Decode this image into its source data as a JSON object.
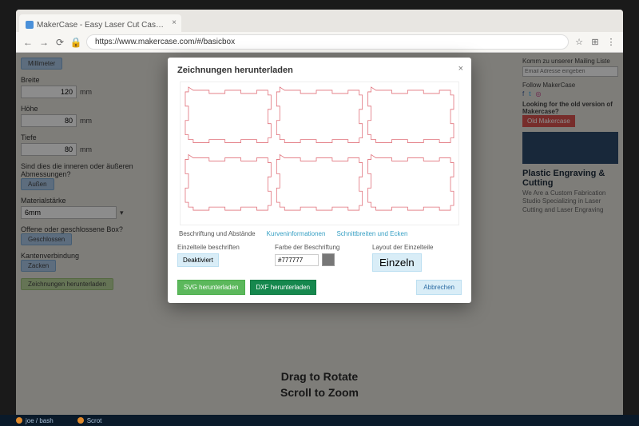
{
  "browser": {
    "tab_title": "MakerCase - Easy Laser Cut Cas…",
    "url": "https://www.makercase.com/#/basicbox",
    "icons": {
      "back": "←",
      "fwd": "→",
      "reload": "⟳",
      "lock": "🔒",
      "star": "☆",
      "ext": "⋮"
    }
  },
  "page": {
    "left": {
      "unit_btn": "Millimeter",
      "width_label": "Breite",
      "width_val": "120",
      "unit": "mm",
      "height_label": "Höhe",
      "height_val": "80",
      "depth_label": "Tiefe",
      "depth_val": "80",
      "dims_q": "Sind dies die inneren oder äußeren Abmessungen?",
      "dims_btn": "Außen",
      "mat_label": "Materialstärke",
      "mat_val": "6mm",
      "open_label": "Offene oder geschlossene Box?",
      "open_btn": "Geschlossen",
      "joint_label": "Kantenverbindung",
      "joint_btn": "Zacken",
      "dl_btn": "Zeichnungen herunterladen"
    },
    "hints": {
      "drag": "Drag to Rotate",
      "scroll": "Scroll to Zoom"
    },
    "right": {
      "mail_title": "Komm zu unserer Mailing Liste",
      "mail_ph": "Email Adresse eingeben",
      "follow": "Follow MakerCase",
      "looking": "Looking for the old version of Makercase?",
      "old_btn": "Old Makercase",
      "ad_title": "Plastic Engraving & Cutting",
      "ad_body": "We Are a Custom Fabrication Studio Specializing in Laser Cutting and Laser Engraving"
    }
  },
  "modal": {
    "title": "Zeichnungen herunterladen",
    "tabs": {
      "t1": "Beschriftung und Abstände",
      "t2": "Kurveninformationen",
      "t3": "Schnittbreiten und Ecken"
    },
    "label_title": "Einzelteile beschriften",
    "label_btn": "Deaktiviert",
    "color_title": "Farbe der Beschriftung",
    "color_val": "#777777",
    "layout_title": "Layout der Einzelteile",
    "layout_btn": "Einzeln",
    "svg_btn": "SVG herunterladen",
    "dxf_btn": "DXF herunterladen",
    "close_btn": "Abbrechen"
  },
  "taskbar": {
    "a": "joe / bash",
    "b": "Scrot"
  },
  "colors": {
    "line": "#e0707a"
  }
}
